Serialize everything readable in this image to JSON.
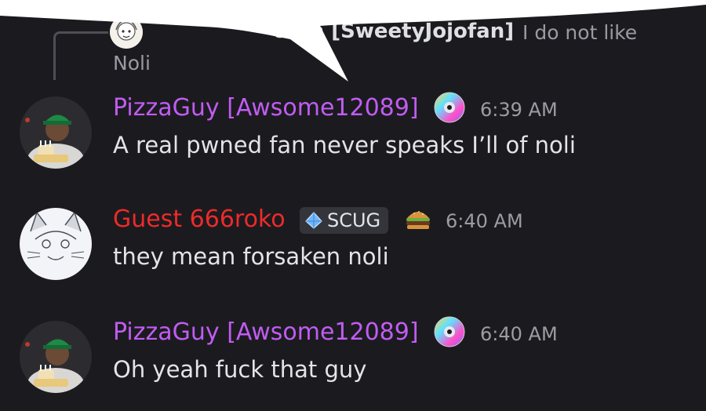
{
  "reply": {
    "name": "ofan [SweetyJojofan]",
    "text_line1": "I do not like",
    "text_line2": "Noli"
  },
  "messages": [
    {
      "author": "PizzaGuy [Awsome12089]",
      "author_color": "#c15cf2",
      "badge_icon": "cd-disc-icon",
      "time": "6:39 AM",
      "text": "A real pwned fan never speaks I’ll of noli"
    },
    {
      "author": "Guest 666roko",
      "author_color": "#ee2a2a",
      "tag_icon": "gem-icon",
      "tag_label": "SCUG",
      "badge_icon": "burger-icon",
      "time": "6:40 AM",
      "text": "they mean forsaken noli"
    },
    {
      "author": "PizzaGuy [Awsome12089]",
      "author_color": "#c15cf2",
      "badge_icon": "cd-disc-icon",
      "time": "6:40 AM",
      "text": "Oh yeah fuck that guy"
    }
  ]
}
